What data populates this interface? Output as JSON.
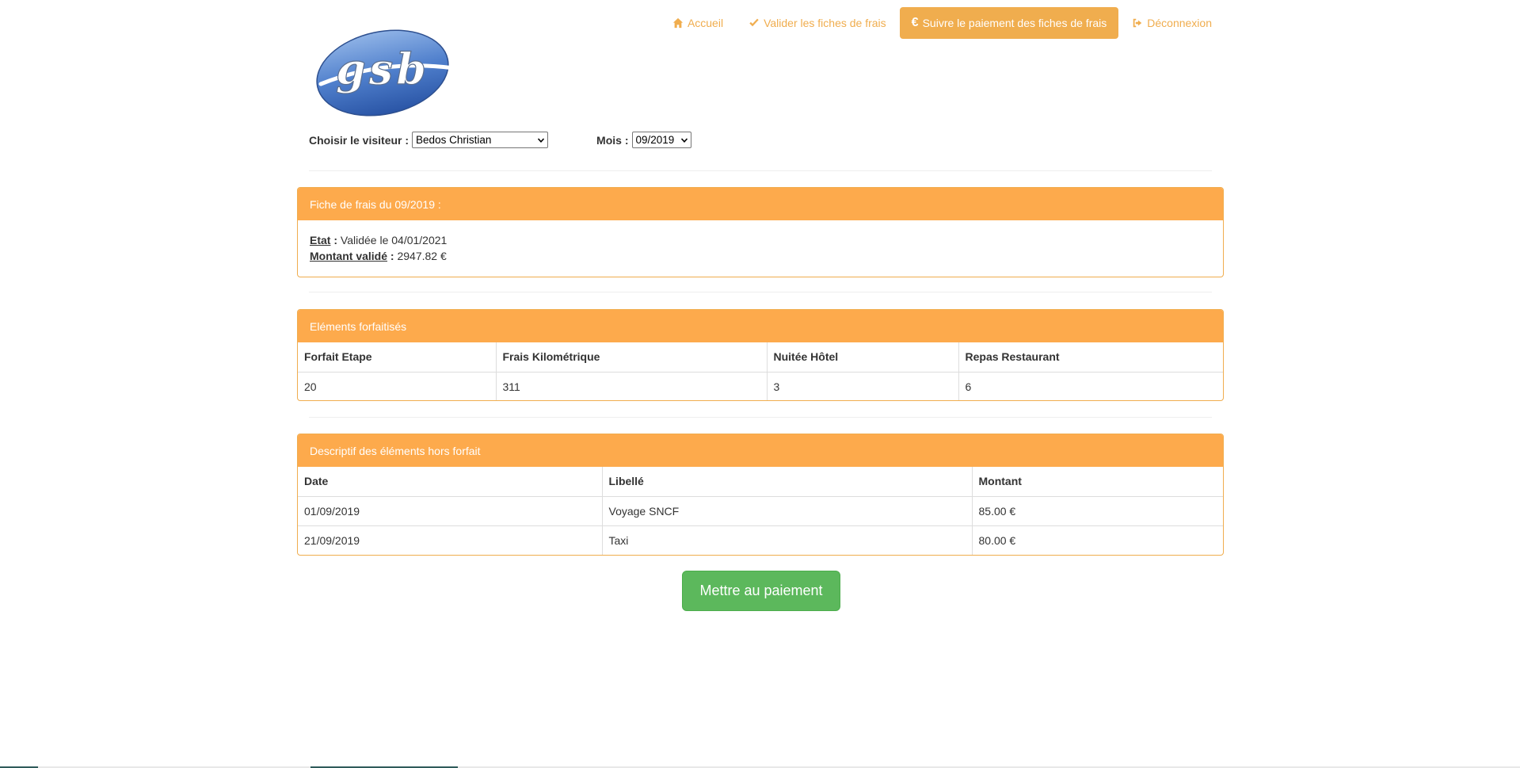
{
  "nav": {
    "items": [
      {
        "label": "Accueil",
        "icon": "home-icon"
      },
      {
        "label": "Valider les fiches de frais",
        "icon": "check-icon"
      },
      {
        "label": "Suivre le paiement des fiches de frais",
        "icon": "euro-icon",
        "active": true
      },
      {
        "label": "Déconnexion",
        "icon": "logout-icon"
      }
    ]
  },
  "logo": {
    "text": "gsb"
  },
  "selectors": {
    "visitor_label": "Choisir le visiteur :",
    "visitor_value": "Bedos Christian",
    "month_label": "Mois :",
    "month_value": "09/2019"
  },
  "fiche": {
    "heading": "Fiche de frais du 09/2019 :",
    "etat_label": "Etat",
    "etat_value": "Validée le 04/01/2021",
    "montant_label": "Montant validé",
    "montant_value": "2947.82 €"
  },
  "forfait": {
    "heading": "Eléments forfaitisés",
    "columns": [
      "Forfait Etape",
      "Frais Kilométrique",
      "Nuitée Hôtel",
      "Repas Restaurant"
    ],
    "values": [
      "20",
      "311",
      "3",
      "6"
    ]
  },
  "hors_forfait": {
    "heading": "Descriptif des éléments hors forfait",
    "columns": [
      "Date",
      "Libellé",
      "Montant"
    ],
    "rows": [
      [
        "01/09/2019",
        "Voyage SNCF",
        "85.00 €"
      ],
      [
        "21/09/2019",
        "Taxi",
        "80.00 €"
      ]
    ]
  },
  "pay_button": "Mettre au paiement",
  "colors": {
    "accent": "#f0ad4e",
    "success": "#5cb85c"
  }
}
